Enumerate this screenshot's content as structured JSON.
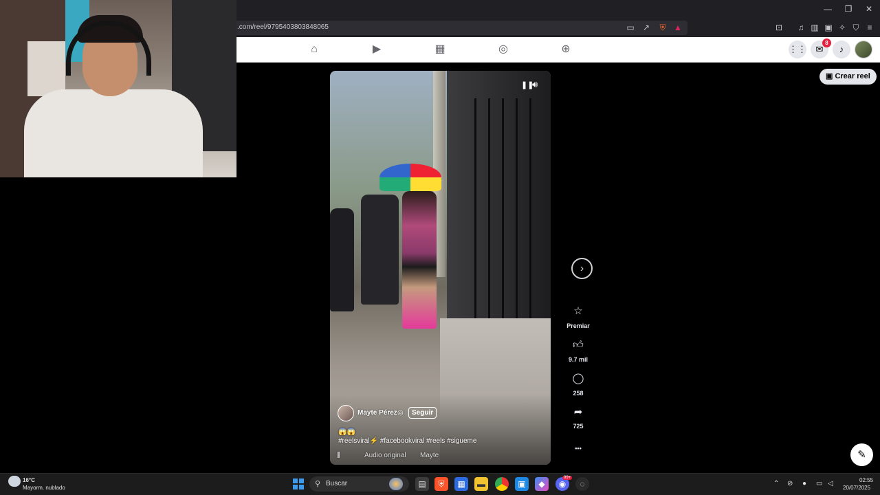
{
  "browser": {
    "url": ".com/reel/9795403803848065",
    "window_controls": [
      "—",
      "❐",
      "✕"
    ]
  },
  "fb_nav": {
    "tabs": [
      "home-icon",
      "video-icon",
      "marketplace-icon",
      "groups-icon",
      "gaming-icon"
    ],
    "messenger_badge": "8"
  },
  "reel": {
    "author": "Mayte Pérez",
    "follow_label": "Seguir",
    "emoji_line": "😱😱",
    "caption": "#reelsviral⚡ #facebookviral #reels #sigueme",
    "audio_label": "Audio original",
    "audio_author": "Mayte"
  },
  "actions": {
    "premiar_label": "Premiar",
    "likes": "9.7 mil",
    "comments": "258",
    "shares": "725",
    "more": "•••"
  },
  "buttons": {
    "crear_reel": "Crear reel",
    "next": "›"
  },
  "taskbar": {
    "weather_temp": "16°C",
    "weather_desc": "Mayorm. nublado",
    "search_placeholder": "Buscar",
    "time": "02:55",
    "date": "20/07/2025",
    "notification_badge": "99+"
  },
  "colors": {
    "fb_nav_bg": "#ffffff",
    "page_bg": "#000000",
    "badge": "#e41e3f",
    "taskbar_bg": "#1c1c1c"
  }
}
